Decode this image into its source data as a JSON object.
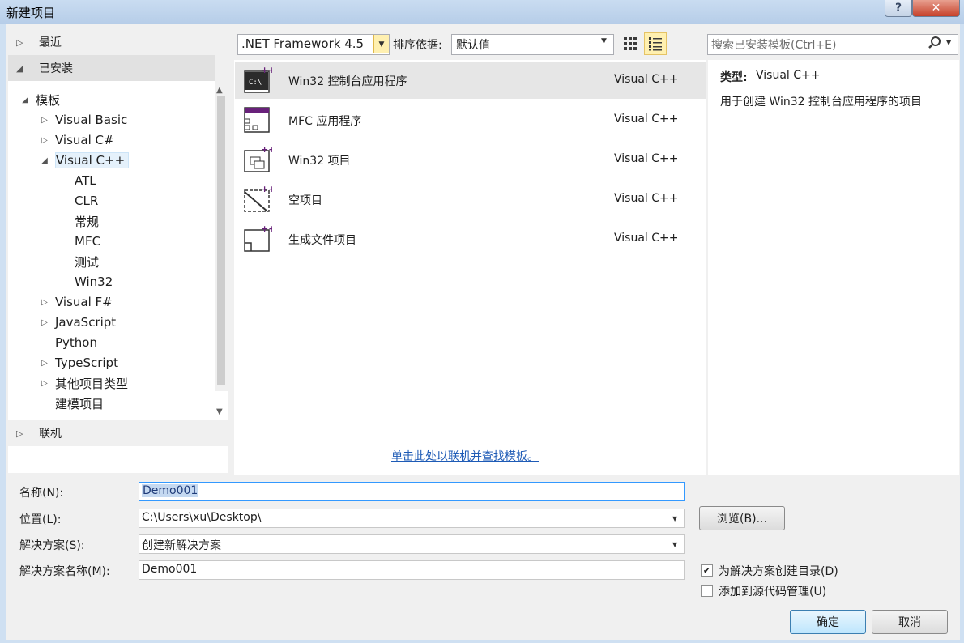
{
  "window": {
    "title": "新建项目",
    "help_icon": "?",
    "close_icon": "✕"
  },
  "left_nav": {
    "recent": "最近",
    "installed": "已安装",
    "online": "联机",
    "templates": "模板",
    "tree": [
      {
        "label": "Visual Basic",
        "expander": "collapsed"
      },
      {
        "label": "Visual C#",
        "expander": "collapsed"
      },
      {
        "label": "Visual C++",
        "expander": "expanded",
        "selected": true
      },
      {
        "label": "ATL"
      },
      {
        "label": "CLR"
      },
      {
        "label": "常规"
      },
      {
        "label": "MFC"
      },
      {
        "label": "测试"
      },
      {
        "label": "Win32"
      },
      {
        "label": "Visual F#",
        "expander": "collapsed"
      },
      {
        "label": "JavaScript",
        "expander": "collapsed"
      },
      {
        "label": "Python"
      },
      {
        "label": "TypeScript",
        "expander": "collapsed"
      },
      {
        "label": "其他项目类型",
        "expander": "collapsed"
      },
      {
        "label": "建模项目"
      }
    ]
  },
  "toolbar": {
    "framework": ".NET Framework 4.5",
    "sort_label": "排序依据:",
    "sort_value": "默认值",
    "search_placeholder": "搜索已安装模板(Ctrl+E)"
  },
  "templates": [
    {
      "name": "Win32 控制台应用程序",
      "lang": "Visual C++",
      "icon": "console-app-icon",
      "selected": true
    },
    {
      "name": "MFC 应用程序",
      "lang": "Visual C++",
      "icon": "mfc-app-icon"
    },
    {
      "name": "Win32 项目",
      "lang": "Visual C++",
      "icon": "win32-project-icon"
    },
    {
      "name": "空项目",
      "lang": "Visual C++",
      "icon": "empty-project-icon"
    },
    {
      "name": "生成文件项目",
      "lang": "Visual C++",
      "icon": "makefile-project-icon"
    }
  ],
  "online_link": "单击此处以联机并查找模板。",
  "details": {
    "type_label": "类型:",
    "type_value": "Visual C++",
    "description": "用于创建 Win32 控制台应用程序的项目"
  },
  "form": {
    "name_label": "名称(N):",
    "name_value": "Demo001",
    "location_label": "位置(L):",
    "location_value": "C:\\Users\\xu\\Desktop\\",
    "solution_label": "解决方案(S):",
    "solution_value": "创建新解决方案",
    "solution_name_label": "解决方案名称(M):",
    "solution_name_value": "Demo001",
    "browse": "浏览(B)...",
    "create_dir": "为解决方案创建目录(D)",
    "create_dir_checked": true,
    "add_source_control": "添加到源代码管理(U)",
    "add_source_control_checked": false,
    "ok": "确定",
    "cancel": "取消"
  },
  "colors": {
    "accent_purple": "#68217a",
    "selection": "#e5f1fb",
    "link": "#1e5bb6"
  }
}
